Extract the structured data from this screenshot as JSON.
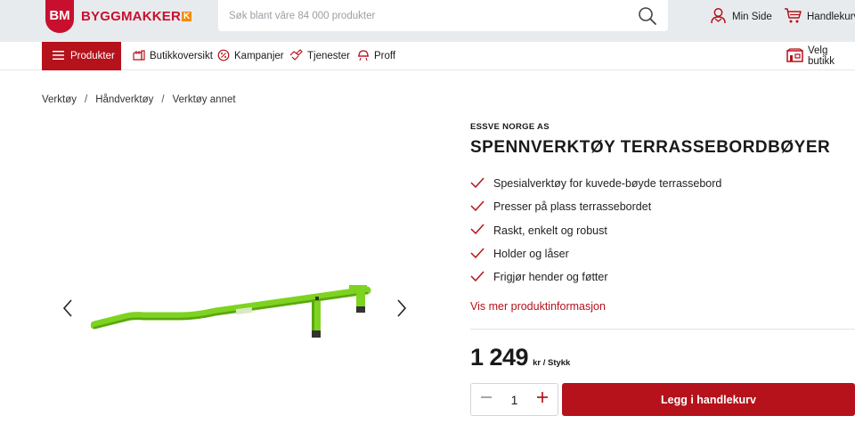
{
  "header": {
    "logo_badge": "BM",
    "logo_text": "BYGGMAKKER",
    "logo_k": "K",
    "search_placeholder": "Søk blant våre 84 000 produkter",
    "my_page": "Min Side",
    "cart": "Handlekurv"
  },
  "nav": {
    "products": "Produkter",
    "items": [
      "Butikkoversikt",
      "Kampanjer",
      "Tjenester",
      "Proff"
    ],
    "select_store": "Velg butikk"
  },
  "breadcrumb": [
    "Verktøy",
    "Håndverktøy",
    "Verktøy annet"
  ],
  "product": {
    "brand": "ESSVE NORGE AS",
    "title": "SPENNVERKTØY TERRASSEBORDBØYER",
    "features": [
      "Spesialverktøy for kuvede-bøyde terrassebord",
      "Presser på plass terrassebordet",
      "Raskt, enkelt og robust",
      "Holder og låser",
      "Frigjør hender og føtter"
    ],
    "more_info": "Vis mer produktinformasjon",
    "price": "1 249",
    "price_unit": "kr / Stykk",
    "quantity": "1",
    "add_to_cart": "Legg i handlekurv"
  },
  "colors": {
    "brand_red": "#b5121b",
    "logo_orange": "#f28c00",
    "header_bg": "#e8ebee",
    "product_green": "#7ed321"
  },
  "icons": [
    "search-icon",
    "user-icon",
    "cart-icon",
    "menu-icon",
    "store-icon",
    "campaign-icon",
    "services-icon",
    "pro-icon",
    "store-select-icon",
    "check-icon",
    "chevron-left-icon",
    "chevron-right-icon",
    "minus-icon",
    "plus-icon"
  ]
}
